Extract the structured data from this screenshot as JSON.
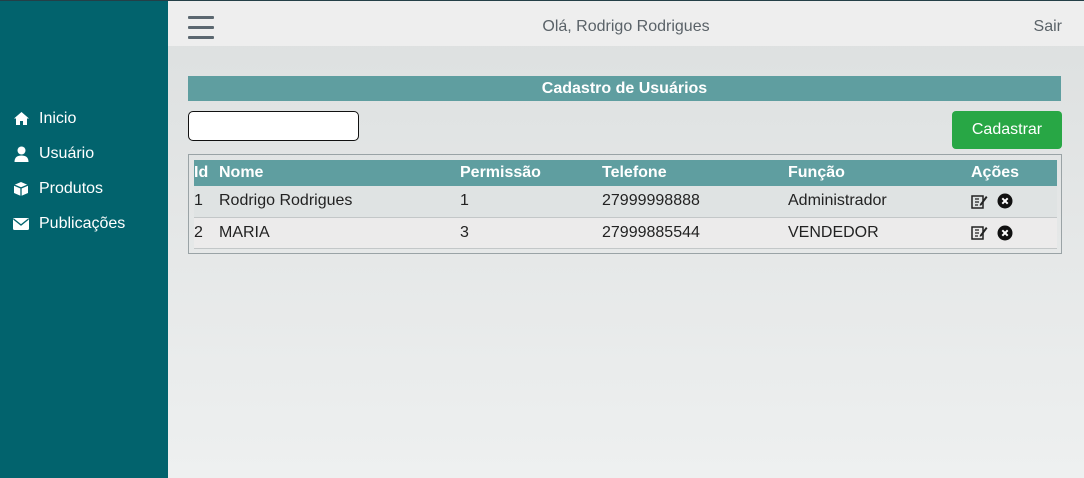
{
  "sidebar": {
    "items": [
      {
        "label": "Inicio",
        "icon": "home-icon"
      },
      {
        "label": "Usuário",
        "icon": "user-icon"
      },
      {
        "label": "Produtos",
        "icon": "box-icon"
      },
      {
        "label": "Publicações",
        "icon": "envelope-icon"
      }
    ]
  },
  "header": {
    "greeting": "Olá, Rodrigo Rodrigues",
    "logout_label": "Sair"
  },
  "main": {
    "title": "Cadastro de Usuários",
    "search": {
      "value": "",
      "placeholder": ""
    },
    "register_label": "Cadastrar",
    "columns": [
      "Id",
      "Nome",
      "Permissão",
      "Telefone",
      "Função",
      "Ações"
    ],
    "rows": [
      {
        "id": "1",
        "nome": "Rodrigo Rodrigues",
        "permissao": "1",
        "telefone": "27999998888",
        "funcao": "Administrador"
      },
      {
        "id": "2",
        "nome": "MARIA",
        "permissao": "3",
        "telefone": "27999885544",
        "funcao": "VENDEDOR"
      }
    ]
  },
  "colors": {
    "sidebar": "#02636d",
    "header_bar": "#5f9ea0",
    "register_button": "#28a745"
  }
}
